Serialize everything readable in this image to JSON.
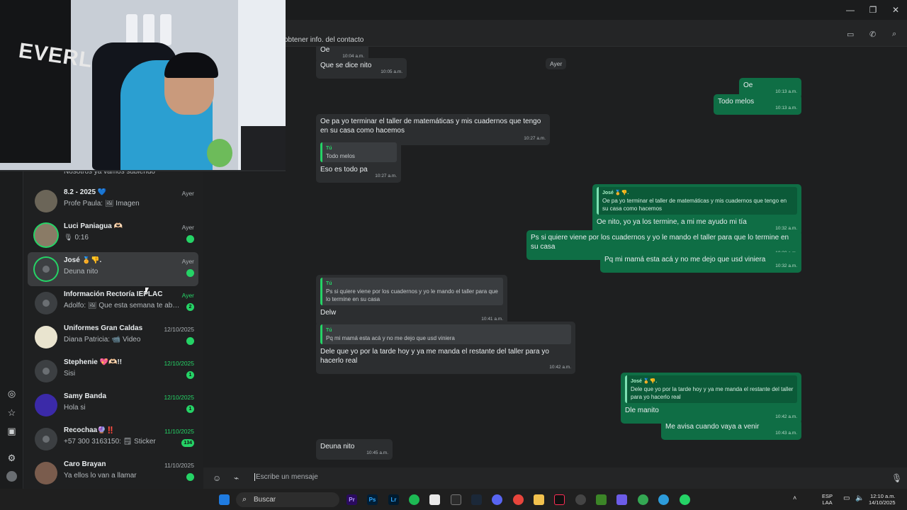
{
  "window": {
    "minimize": "—",
    "restore": "❐",
    "close": "✕"
  },
  "chat_list": {
    "first_preview": "Nosotros ya vamos subiendo",
    "items": [
      {
        "name": "8.2 - 2025 💙",
        "preview": "Profe Paula: 🖼 Imagen",
        "time": "Ayer",
        "time_green": false,
        "unread": ""
      },
      {
        "name": "Luci Paniagua 🫶🏻",
        "preview": "🎙 0:16",
        "time": "Ayer",
        "time_green": false,
        "unread": ""
      },
      {
        "name": "José 🏅👎.",
        "preview": "Deuna nito",
        "time": "Ayer",
        "time_green": false,
        "unread": ""
      },
      {
        "name": "Información Rectoría IEPLAC",
        "preview": "Adolfo: 🖼 Que esta semana te abrace...",
        "time": "Ayer",
        "time_green": true,
        "unread": "2"
      },
      {
        "name": "Uniformes Gran Caldas",
        "preview": "Diana Patricia: 📹 Video",
        "time": "12/10/2025",
        "time_green": false,
        "unread": ""
      },
      {
        "name": "Stephenie 💖🫶🏻!!",
        "preview": "Sisi",
        "time": "12/10/2025",
        "time_green": true,
        "unread": "1"
      },
      {
        "name": "Samy Banda",
        "preview": "Hola si",
        "time": "12/10/2025",
        "time_green": true,
        "unread": "1"
      },
      {
        "name": "Recochaa🔮‼️",
        "preview": "+57 300 3163150: 🗒 Sticker",
        "time": "11/10/2025",
        "time_green": true,
        "unread": "134"
      },
      {
        "name": "Caro Brayan",
        "preview": "Ya ellos lo van a llamar",
        "time": "11/10/2025",
        "time_green": false,
        "unread": ""
      }
    ]
  },
  "header": {
    "hint": "obtener info. del contacto"
  },
  "conversation": {
    "day_pill": "Ayer",
    "messages": {
      "m0": {
        "text": "Oe",
        "time": "10:04 a.m."
      },
      "m1": {
        "text": "Que se dice nito",
        "time": "10:05 a.m."
      },
      "m2": {
        "text": "Oe",
        "time": "10:13 a.m."
      },
      "m3": {
        "text": "Todo melos",
        "time": "10:13 a.m."
      },
      "m4": {
        "text": "Oe pa yo terminar el taller de matemáticas y mis cuadernos que tengo en su casa como hacemos",
        "time": "10:27 a.m."
      },
      "m5": {
        "quote_name": "Tú",
        "quote_text": "Todo melos",
        "text": "Eso es todo pa",
        "time": "10:27 a.m."
      },
      "m6": {
        "quote_name": "José 🏅👎.",
        "quote_text": "Oe pa yo terminar el taller de matemáticas y mis cuadernos que tengo en su casa como hacemos",
        "text": "Oe nito, yo ya los termine, a mi me ayudo mi tía",
        "time": "10:32 a.m."
      },
      "m7": {
        "text": "Ps si quiere viene por los cuadernos y yo le mando el taller para que lo termine en su casa",
        "time": "10:32 a.m."
      },
      "m8": {
        "text": "Pq mi mamá esta acá y no me dejo que usd viniera",
        "time": "10:32 a.m."
      },
      "m9": {
        "quote_name": "Tú",
        "quote_text": "Ps si quiere viene por los cuadernos y yo le mando el taller para que lo termine en su casa",
        "text": "Delw",
        "time": "10:41 a.m."
      },
      "m10": {
        "quote_name": "Tú",
        "quote_text": "Pq mi mamá esta acá y no me dejo que usd viniera",
        "text": "Dele que yo por la tarde hoy y ya me manda el restante del taller para yo hacerlo real",
        "time": "10:42 a.m."
      },
      "m11": {
        "quote_name": "José 🏅👎.",
        "quote_text": "Dele que yo por la tarde hoy y ya me manda el restante del taller para yo hacerlo real",
        "text": "Dle manito",
        "time": "10:42 a.m."
      },
      "m12": {
        "text": "Me avisa cuando vaya a venir",
        "time": "10:43 a.m."
      },
      "m13": {
        "text": "Deuna nito",
        "time": "10:45 a.m."
      }
    }
  },
  "composer": {
    "placeholder": "Escribe un mensaje"
  },
  "webcam": {
    "bag_text": "EVERL"
  },
  "taskbar": {
    "search": "Buscar",
    "apps": [
      "Pr",
      "Ps",
      "Lr"
    ],
    "lang": "ESP",
    "lang2": "LAA",
    "clock_time": "12:10 a.m.",
    "clock_date": "14/10/2025"
  },
  "colors": {
    "accent": "#25d366",
    "outgoing": "#0f6e45",
    "incoming": "#2c2e30"
  }
}
